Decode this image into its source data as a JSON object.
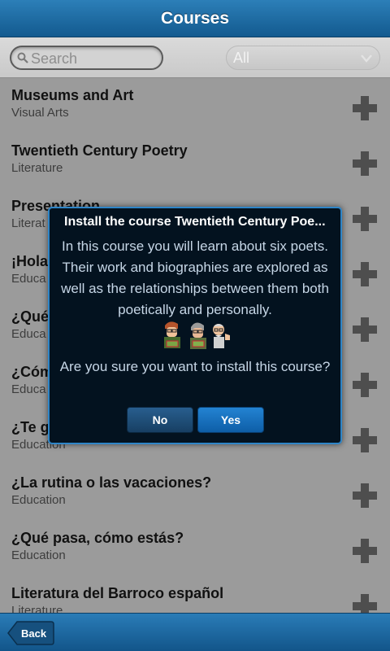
{
  "header": {
    "title": "Courses"
  },
  "search": {
    "placeholder": "Search"
  },
  "filter": {
    "selected": "All"
  },
  "courses": [
    {
      "title": "Museums and Art",
      "category": "Visual Arts"
    },
    {
      "title": "Twentieth Century Poetry",
      "category": "Literature"
    },
    {
      "title": "Presentation",
      "category": "Literat"
    },
    {
      "title": "¡Hola",
      "category": "Educa"
    },
    {
      "title": "¿Qué",
      "category": "Educa"
    },
    {
      "title": "¿Cóm",
      "category": "Educa"
    },
    {
      "title": "¿Te g",
      "category": "Education"
    },
    {
      "title": "¿La rutina o las vacaciones?",
      "category": "Education"
    },
    {
      "title": "¿Qué pasa, cómo estás?",
      "category": "Education"
    },
    {
      "title": "Literatura del Barroco español",
      "category": "Literature"
    }
  ],
  "dialog": {
    "title": "Install the course Twentieth Century Poe...",
    "body": "In this course you will learn about six poets. Their work and biographies are explored as well as the relationships between them both poetically and personally.",
    "question": "Are you sure you want to install this course?",
    "no_label": "No",
    "yes_label": "Yes"
  },
  "footer": {
    "back_label": "Back"
  },
  "icons": {
    "add": "plus-icon",
    "search": "magnifier-icon",
    "chevron": "chevron-down-icon",
    "poets": "poet-characters-illustration"
  },
  "colors": {
    "header": "#1f6ea8",
    "dialog_bg": "#03121f",
    "dialog_border": "#2f86c8",
    "button_yes": "#1670c0",
    "button_no": "#1d4d77"
  }
}
